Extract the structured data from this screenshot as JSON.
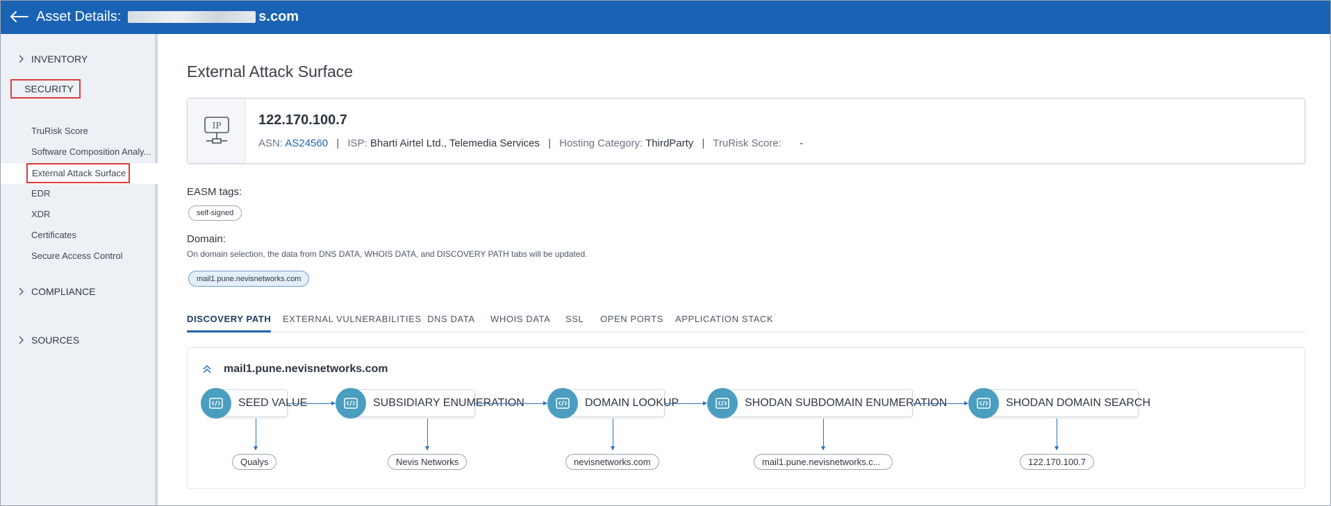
{
  "header": {
    "title_prefix": "Asset Details:",
    "title_suffix": "s.com"
  },
  "sidebar": {
    "sections": [
      {
        "label": "INVENTORY"
      },
      {
        "label": "SECURITY"
      },
      {
        "label": "COMPLIANCE"
      },
      {
        "label": "SOURCES"
      }
    ],
    "security_items": [
      {
        "label": "TruRisk Score"
      },
      {
        "label": "Software Composition Analy..."
      },
      {
        "label": "External Attack Surface"
      },
      {
        "label": "EDR"
      },
      {
        "label": "XDR"
      },
      {
        "label": "Certificates"
      },
      {
        "label": "Secure Access Control"
      }
    ]
  },
  "main": {
    "page_title": "External Attack Surface",
    "card": {
      "ip": "122.170.100.7",
      "asn_label": "ASN:",
      "asn_value": "AS24560",
      "isp_label": "ISP:",
      "isp_value": "Bharti Airtel Ltd., Telemedia Services",
      "hosting_label": "Hosting Category:",
      "hosting_value": "ThirdParty",
      "trurisk_label": "TruRisk Score:",
      "trurisk_value": "-",
      "separator": "|"
    },
    "easm_tags_label": "EASM tags:",
    "easm_tags": [
      "self-signed"
    ],
    "domain_label": "Domain:",
    "domain_hint": "On domain selection, the data from DNS DATA, WHOIS DATA, and DISCOVERY PATH tabs will be updated.",
    "domain_selected": "mail1.pune.nevisnetworks.com",
    "tabs": [
      {
        "label": "DISCOVERY PATH"
      },
      {
        "label": "EXTERNAL VULNERABILITIES"
      },
      {
        "label": "DNS DATA"
      },
      {
        "label": "WHOIS DATA"
      },
      {
        "label": "SSL"
      },
      {
        "label": "OPEN PORTS"
      },
      {
        "label": "APPLICATION STACK"
      }
    ],
    "active_tab": "DISCOVERY PATH",
    "discovery": {
      "title": "mail1.pune.nevisnetworks.com",
      "steps": [
        {
          "label": "SEED VALUE",
          "result": "Qualys"
        },
        {
          "label": "SUBSIDIARY ENUMERATION",
          "result": "Nevis Networks"
        },
        {
          "label": "DOMAIN LOOKUP",
          "result": "nevisnetworks.com"
        },
        {
          "label": "SHODAN SUBDOMAIN ENUMERATION",
          "result": "mail1.pune.nevisnetworks.c..."
        },
        {
          "label": "SHODAN DOMAIN SEARCH",
          "result": "122.170.100.7"
        }
      ]
    }
  },
  "colors": {
    "header_bg": "#1a63b4",
    "sidebar_bg": "#edf1f6",
    "highlight_border": "#e03a3a",
    "node_icon_bg": "#4a9ec0",
    "link": "#1a63b4"
  },
  "icons": {
    "back": "arrow-left-icon",
    "chevron_right": "chevron-right-icon",
    "chevron_down": "chevron-down-icon",
    "ip": "ip-network-icon",
    "collapse": "chevron-double-up-icon",
    "node": "code-icon"
  }
}
